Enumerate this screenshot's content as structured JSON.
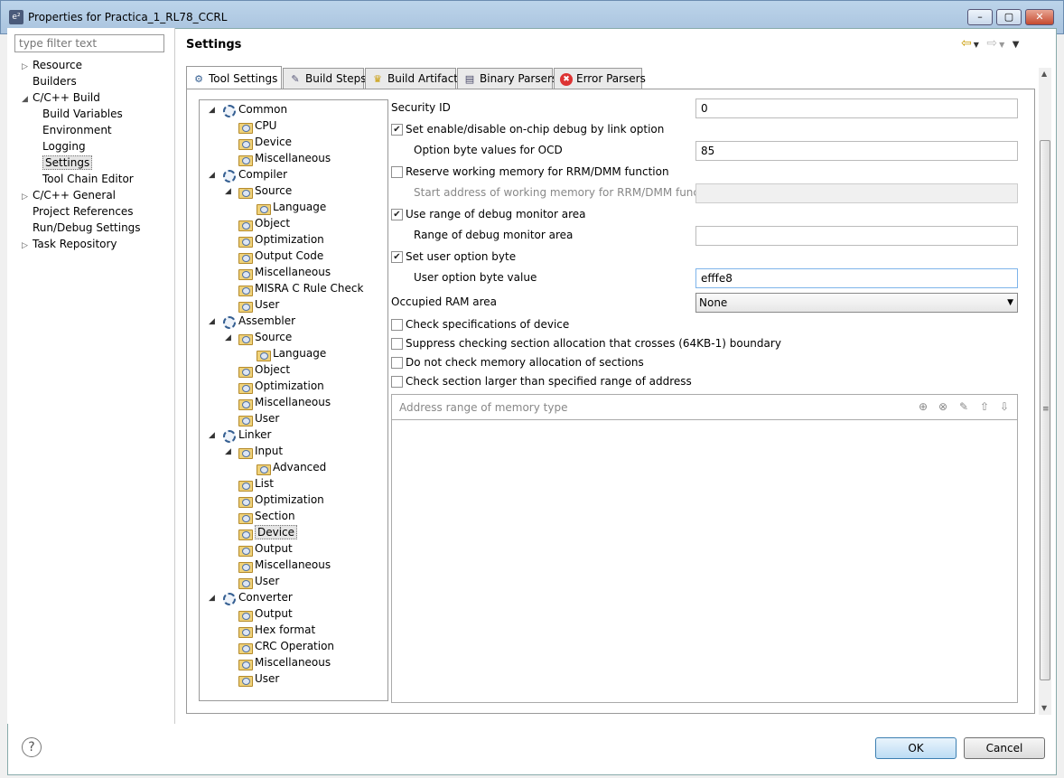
{
  "window": {
    "title": "Properties for Practica_1_RL78_CCRL",
    "icon_label": "e²",
    "minimize": "–",
    "maximize": "▢",
    "close": "✕"
  },
  "filter": {
    "placeholder": "type filter text"
  },
  "nav": [
    {
      "label": "Resource",
      "twisty": "▷"
    },
    {
      "label": "Builders",
      "twisty": ""
    },
    {
      "label": "C/C++ Build",
      "twisty": "◢"
    },
    {
      "label": "Build Variables",
      "twisty": ""
    },
    {
      "label": "Environment",
      "twisty": ""
    },
    {
      "label": "Logging",
      "twisty": ""
    },
    {
      "label": "Settings",
      "twisty": ""
    },
    {
      "label": "Tool Chain Editor",
      "twisty": ""
    },
    {
      "label": "C/C++ General",
      "twisty": "▷"
    },
    {
      "label": "Project References",
      "twisty": ""
    },
    {
      "label": "Run/Debug Settings",
      "twisty": ""
    },
    {
      "label": "Task Repository",
      "twisty": "▷"
    }
  ],
  "header": {
    "title": "Settings",
    "back": "⇦",
    "forward": "⇨",
    "menu": "▼"
  },
  "tabs": [
    {
      "label": "Tool Settings",
      "icon": "⚙"
    },
    {
      "label": "Build Steps",
      "icon": "✎"
    },
    {
      "label": "Build Artifact",
      "icon": "♛"
    },
    {
      "label": "Binary Parsers",
      "icon": "▤"
    },
    {
      "label": "Error Parsers",
      "icon": "✖"
    }
  ],
  "tree": [
    {
      "label": "Common",
      "type": "gear",
      "twisty": "◢"
    },
    {
      "label": "CPU",
      "type": "folder",
      "twisty": ""
    },
    {
      "label": "Device",
      "type": "folder",
      "twisty": ""
    },
    {
      "label": "Miscellaneous",
      "type": "folder",
      "twisty": ""
    },
    {
      "label": "Compiler",
      "type": "gear",
      "twisty": "◢"
    },
    {
      "label": "Source",
      "type": "folder",
      "twisty": "◢"
    },
    {
      "label": "Language",
      "type": "folder",
      "twisty": ""
    },
    {
      "label": "Object",
      "type": "folder",
      "twisty": ""
    },
    {
      "label": "Optimization",
      "type": "folder",
      "twisty": ""
    },
    {
      "label": "Output Code",
      "type": "folder",
      "twisty": ""
    },
    {
      "label": "Miscellaneous",
      "type": "folder",
      "twisty": ""
    },
    {
      "label": "MISRA C Rule Check",
      "type": "folder",
      "twisty": ""
    },
    {
      "label": "User",
      "type": "folder",
      "twisty": ""
    },
    {
      "label": "Assembler",
      "type": "gear",
      "twisty": "◢"
    },
    {
      "label": "Source",
      "type": "folder",
      "twisty": "◢"
    },
    {
      "label": "Language",
      "type": "folder",
      "twisty": ""
    },
    {
      "label": "Object",
      "type": "folder",
      "twisty": ""
    },
    {
      "label": "Optimization",
      "type": "folder",
      "twisty": ""
    },
    {
      "label": "Miscellaneous",
      "type": "folder",
      "twisty": ""
    },
    {
      "label": "User",
      "type": "folder",
      "twisty": ""
    },
    {
      "label": "Linker",
      "type": "gear",
      "twisty": "◢"
    },
    {
      "label": "Input",
      "type": "folder",
      "twisty": "◢"
    },
    {
      "label": "Advanced",
      "type": "folder",
      "twisty": ""
    },
    {
      "label": "List",
      "type": "folder",
      "twisty": ""
    },
    {
      "label": "Optimization",
      "type": "folder",
      "twisty": ""
    },
    {
      "label": "Section",
      "type": "folder",
      "twisty": ""
    },
    {
      "label": "Device",
      "type": "folder",
      "twisty": ""
    },
    {
      "label": "Output",
      "type": "folder",
      "twisty": ""
    },
    {
      "label": "Miscellaneous",
      "type": "folder",
      "twisty": ""
    },
    {
      "label": "User",
      "type": "folder",
      "twisty": ""
    },
    {
      "label": "Converter",
      "type": "gear",
      "twisty": "◢"
    },
    {
      "label": "Output",
      "type": "folder",
      "twisty": ""
    },
    {
      "label": "Hex format",
      "type": "folder",
      "twisty": ""
    },
    {
      "label": "CRC Operation",
      "type": "folder",
      "twisty": ""
    },
    {
      "label": "Miscellaneous",
      "type": "folder",
      "twisty": ""
    },
    {
      "label": "User",
      "type": "folder",
      "twisty": ""
    }
  ],
  "form": {
    "security_id_label": "Security ID",
    "security_id_value": "0",
    "ocd_enable_label": "Set enable/disable on-chip debug by link option",
    "ocd_enable_checked": "✔",
    "ocd_byte_label": "Option byte values for OCD",
    "ocd_byte_value": "85",
    "rrm_label": "Reserve working memory for RRM/DMM function",
    "rrm_checked": "",
    "rrm_start_label": "Start address of working memory for RRM/DMM function",
    "rrm_start_value": "",
    "debug_monitor_label": "Use range of debug monitor area",
    "debug_monitor_checked": "✔",
    "debug_range_label": "Range of debug monitor area",
    "debug_range_value": "",
    "user_option_label": "Set user option byte",
    "user_option_checked": "✔",
    "user_option_value_label": "User option byte value",
    "user_option_value": "efffe8",
    "ram_area_label": "Occupied RAM area",
    "ram_area_value": "None",
    "check_device_label": "Check specifications of device",
    "check_device_checked": "",
    "suppress_label": "Suppress checking section allocation that crosses (64KB-1) boundary",
    "suppress_checked": "",
    "no_mem_check_label": "Do not check memory allocation of sections",
    "no_mem_check_checked": "",
    "section_larger_label": "Check section larger than specified range of address",
    "section_larger_checked": "",
    "addr_range_label": "Address range of memory type"
  },
  "buttons": {
    "help": "?",
    "ok": "OK",
    "cancel": "Cancel"
  }
}
